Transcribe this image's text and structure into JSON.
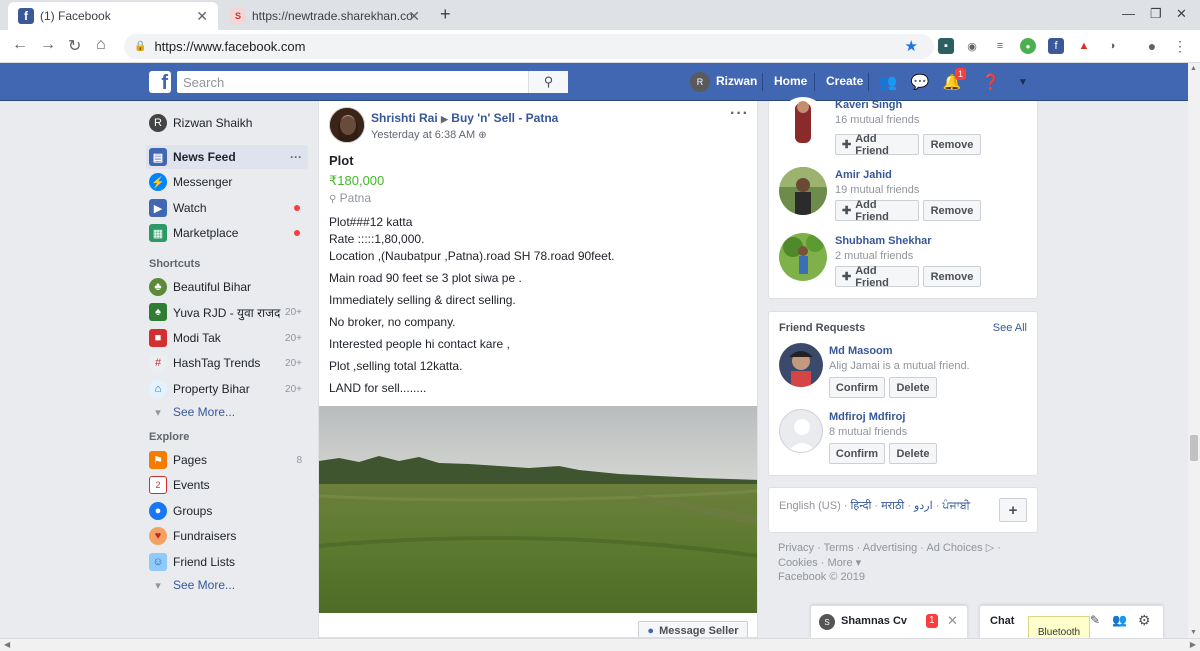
{
  "browser": {
    "tabs": [
      {
        "title": "(1) Facebook",
        "icon": "facebook-favicon"
      },
      {
        "title": "https://newtrade.sharekhan.co",
        "icon": "sharekhan-favicon"
      }
    ],
    "url": "https://www.facebook.com"
  },
  "header": {
    "search_placeholder": "Search",
    "user_name": "Rizwan",
    "home_label": "Home",
    "create_label": "Create",
    "notif_count": "1",
    "brand_color": "#4267b2"
  },
  "left_nav": {
    "profile_name": "Rizwan Shaikh",
    "main_items": [
      {
        "label": "News Feed",
        "icon": "news-feed-icon"
      },
      {
        "label": "Messenger",
        "icon": "messenger-icon"
      },
      {
        "label": "Watch",
        "icon": "watch-icon"
      },
      {
        "label": "Marketplace",
        "icon": "marketplace-icon"
      }
    ],
    "shortcuts_heading": "Shortcuts",
    "shortcuts": [
      {
        "label": "Beautiful Bihar",
        "count": ""
      },
      {
        "label": "Yuva RJD - युवा राजद",
        "count": "20+"
      },
      {
        "label": "Modi Tak",
        "count": "20+"
      },
      {
        "label": "HashTag Trends",
        "count": "20+"
      },
      {
        "label": "Property Bihar",
        "count": "20+"
      }
    ],
    "see_more": "See More...",
    "explore_heading": "Explore",
    "explore": [
      {
        "label": "Pages",
        "count": "8"
      },
      {
        "label": "Events",
        "count": ""
      },
      {
        "label": "Groups",
        "count": ""
      },
      {
        "label": "Fundraisers",
        "count": ""
      },
      {
        "label": "Friend Lists",
        "count": ""
      }
    ],
    "see_more_2": "See More..."
  },
  "post": {
    "author": "Shrishti Rai",
    "group": "Buy 'n' Sell - Patna",
    "time": "Yesterday at 6:38 AM",
    "title": "Plot",
    "price": "₹180,000",
    "location": "Patna",
    "lines": [
      "Plot###12 katta",
      "Rate :::::1,80,000.",
      "Location ,(Naubatpur ,Patna).road SH 78.road 90feet.",
      "Main road 90 feet se 3 plot siwa pe .",
      "Immediately selling & direct selling.",
      "No broker, no company.",
      "Interested people hi contact kare ,",
      "Plot ,selling total 12katta.",
      "LAND for sell........"
    ],
    "message_seller": "Message Seller"
  },
  "people_you_may_know": [
    {
      "name": "Kaveri Singh",
      "mutual": "16 mutual friends",
      "add": "Add Friend",
      "remove": "Remove"
    },
    {
      "name": "Amir Jahid",
      "mutual": "19 mutual friends",
      "add": "Add Friend",
      "remove": "Remove"
    },
    {
      "name": "Shubham Shekhar",
      "mutual": "2 mutual friends",
      "add": "Add Friend",
      "remove": "Remove"
    }
  ],
  "friend_requests": {
    "title": "Friend Requests",
    "see_all": "See All",
    "items": [
      {
        "name": "Md Masoom",
        "sub": "Alig Jamai is a mutual friend.",
        "confirm": "Confirm",
        "delete": "Delete"
      },
      {
        "name": "Mdfiroj Mdfiroj",
        "sub": "8 mutual friends",
        "confirm": "Confirm",
        "delete": "Delete"
      }
    ]
  },
  "languages": {
    "items": [
      "English (US)",
      "हिन्दी",
      "मराठी",
      "اردو",
      "ਪੰਜਾਬੀ"
    ],
    "add": "+"
  },
  "footer": {
    "links": [
      "Privacy",
      "Terms",
      "Advertising",
      "Ad Choices",
      "Cookies",
      "More"
    ],
    "copyright": "Facebook © 2019"
  },
  "chat": {
    "conversation_name": "Shamnas Cv",
    "conversation_badge": "1",
    "chat_label": "Chat",
    "tooltip": "Bluetooth"
  }
}
